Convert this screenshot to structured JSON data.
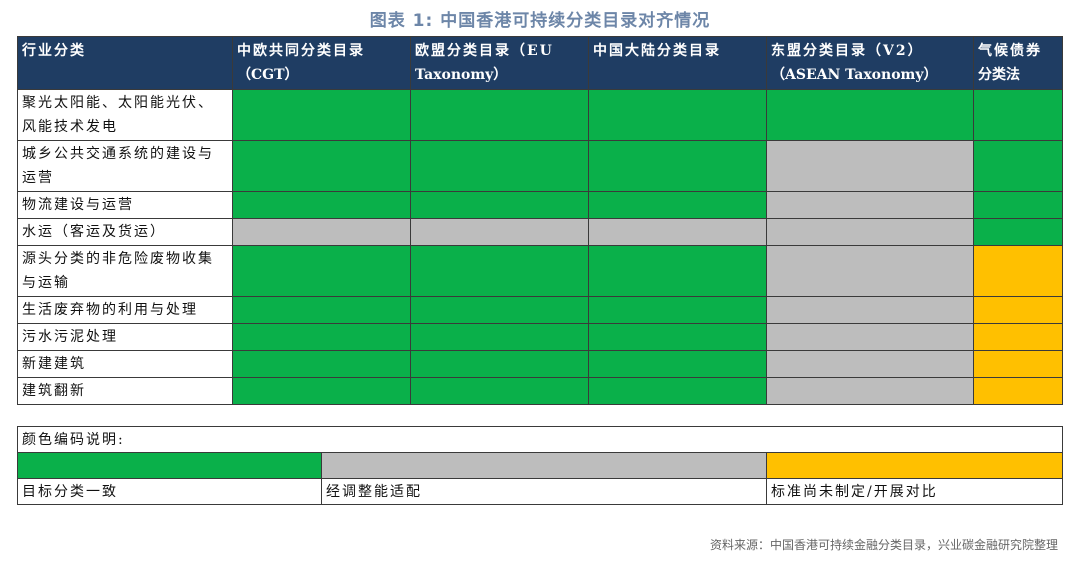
{
  "figure_title": "图表 1:   中国香港可持续分类目录对齐情况",
  "source": "资料来源：中国香港可持续金融分类目录，兴业碳金融研究院整理",
  "chart_data": {
    "type": "table",
    "title": "图表 1:   中国香港可持续分类目录对齐情况",
    "columns": [
      {
        "main": "行业分类",
        "sub": ""
      },
      {
        "main": "中欧共同分类目录",
        "sub": "（CGT）"
      },
      {
        "main": "欧盟分类目录（EU",
        "sub": "Taxonomy）"
      },
      {
        "main": "中国大陆分类目录",
        "sub": ""
      },
      {
        "main": "东盟分类目录（V2）",
        "sub": "（ASEAN Taxonomy）"
      },
      {
        "main": "气候债券",
        "sub": "分类法"
      }
    ],
    "rows": [
      {
        "industry": "聚光太阳能、太阳能光伏、风能技术发电",
        "status": [
          "green",
          "green",
          "green",
          "green",
          "green"
        ]
      },
      {
        "industry": "城乡公共交通系统的建设与运营",
        "status": [
          "green",
          "green",
          "green",
          "grey",
          "green"
        ]
      },
      {
        "industry": "物流建设与运营",
        "status": [
          "green",
          "green",
          "green",
          "grey",
          "green"
        ]
      },
      {
        "industry": "水运（客运及货运）",
        "status": [
          "grey",
          "grey",
          "grey",
          "grey",
          "green"
        ]
      },
      {
        "industry": "源头分类的非危险废物收集与运输",
        "status": [
          "green",
          "green",
          "green",
          "grey",
          "amber"
        ]
      },
      {
        "industry": "生活废弃物的利用与处理",
        "status": [
          "green",
          "green",
          "green",
          "grey",
          "amber"
        ]
      },
      {
        "industry": "污水污泥处理",
        "status": [
          "green",
          "green",
          "green",
          "grey",
          "amber"
        ]
      },
      {
        "industry": "新建建筑",
        "status": [
          "green",
          "green",
          "green",
          "grey",
          "amber"
        ]
      },
      {
        "industry": "建筑翻新",
        "status": [
          "green",
          "green",
          "green",
          "grey",
          "amber"
        ]
      }
    ],
    "legend": {
      "title": "颜色编码说明:",
      "items": [
        {
          "key": "green",
          "color": "#0ab04a",
          "label": "目标分类一致"
        },
        {
          "key": "grey",
          "color": "#bdbdbd",
          "label": "经调整能适配"
        },
        {
          "key": "amber",
          "color": "#ffc000",
          "label": "标准尚未制定/开展对比"
        }
      ]
    }
  },
  "colors": {
    "header_bg": "#1f3d63",
    "title": "#6d86a8"
  }
}
